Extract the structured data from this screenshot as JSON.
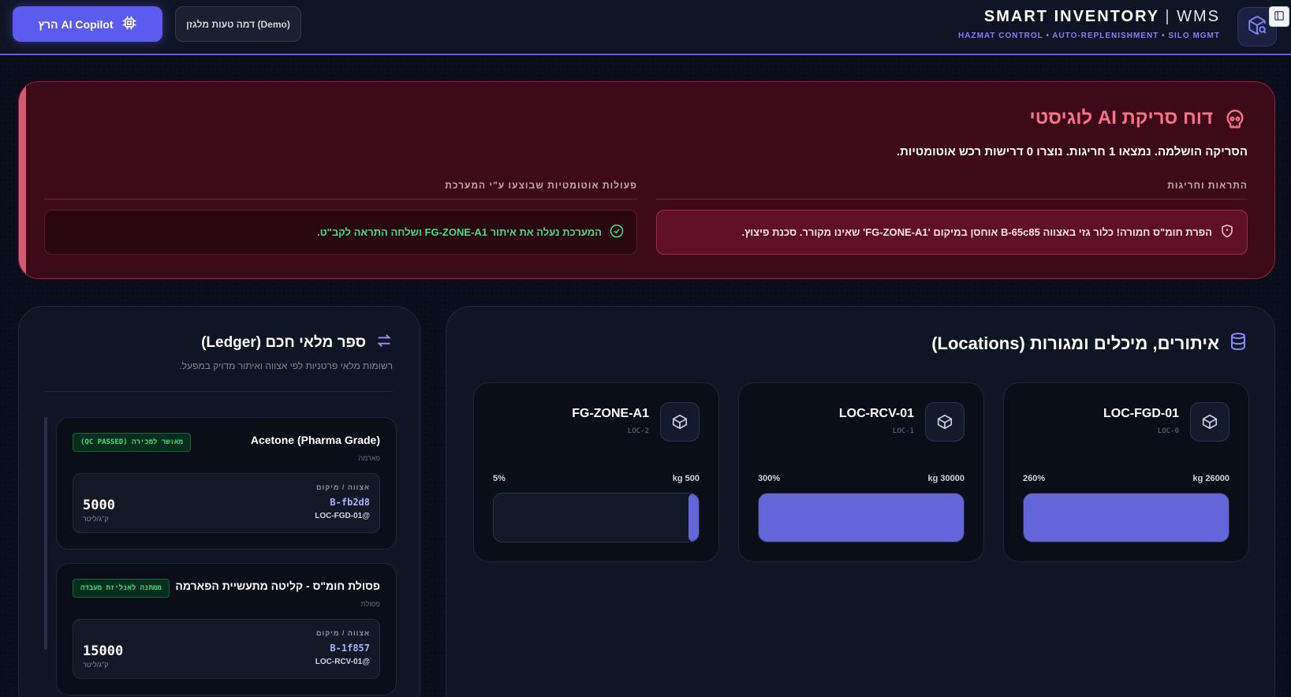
{
  "header": {
    "brand_main": "SMART INVENTORY",
    "brand_sep": "|",
    "brand_suffix": "WMS",
    "brand_subtitle": "HAZMAT CONTROL • AUTO-REPLENISHMENT • SILO MGMT",
    "copilot_button": "הרץ AI Copilot",
    "demo_button": "דמה טעות מלגזן (Demo)"
  },
  "report": {
    "title": "דוח סריקת AI לוגיסטי",
    "summary": "הסריקה הושלמה. נמצאו 1 חריגות. נוצרו 0 דרישות רכש אוטומטיות.",
    "alerts_heading": "התראות וחריגות",
    "actions_heading": "פעולות אוטומטיות שבוצעו ע\"י המערכת",
    "alerts": [
      {
        "text": "הפרת חומ\"ס חמורה! כלור גזי באצווה B-65c85 אוחסן במיקום 'FG-ZONE-A1' שאינו מקורר. סכנת פיצוץ."
      }
    ],
    "actions": [
      {
        "text": "המערכת נעלה את איתור FG-ZONE-A1 ושלחה התראה לקב\"ט."
      }
    ]
  },
  "locations": {
    "title": "איתורים, מיכלים ומגורות (Locations)",
    "items": [
      {
        "name": "LOC-FGD-01",
        "code": "LOC-0",
        "capacity": "26000 kg",
        "percent_label": "260%",
        "fill": 1.0
      },
      {
        "name": "LOC-RCV-01",
        "code": "LOC-1",
        "capacity": "30000 kg",
        "percent_label": "300%",
        "fill": 1.0
      },
      {
        "name": "FG-ZONE-A1",
        "code": "LOC-2",
        "capacity": "500 kg",
        "percent_label": "5%",
        "fill": 0.05
      }
    ]
  },
  "ledger": {
    "title": "ספר מלאי חכם (Ledger)",
    "subtitle": "רשומות מלאי פרטניות לפי אצווה ואיתור מדויק במפעל.",
    "batch_label": "אצווה / מיקום",
    "items": [
      {
        "name": "Acetone (Pharma Grade)",
        "category": "פארמה",
        "status": "מאושר למכירה (QC PASSED)",
        "batch": "B-fb2d8",
        "location": "@LOC-FGD-01",
        "qty": "5000",
        "unit": "ק\"ג/ליטר"
      },
      {
        "name": "פסולת חומ\"ס - קליטה מתעשיית הפארמה",
        "category": "פסולת",
        "status": "ממתנה לאנליזת מעבדה",
        "batch": "B-1f857",
        "location": "@LOC-RCV-01",
        "qty": "15000",
        "unit": "ק\"ג/ליטר"
      }
    ]
  },
  "colors": {
    "accent": "#5b5bf0",
    "danger": "#fb7185",
    "success": "#4ade80",
    "bar_fill": "#6366d8"
  }
}
